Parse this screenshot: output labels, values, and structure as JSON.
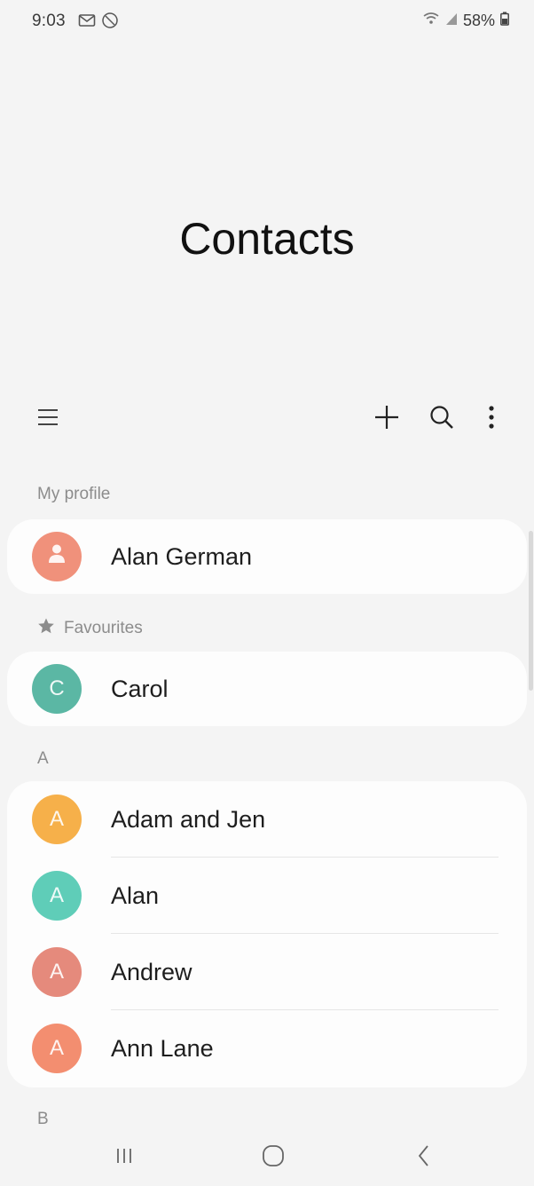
{
  "status_bar": {
    "time": "9:03",
    "battery": "58%"
  },
  "header": {
    "title": "Contacts"
  },
  "toolbar": {
    "icons": [
      "menu-icon",
      "add-icon",
      "search-icon",
      "more-options-icon"
    ]
  },
  "sections": {
    "profile": {
      "header": "My profile",
      "contact": {
        "name": "Alan German",
        "avatar_color": "#f0917b",
        "avatar_icon": "person-icon"
      }
    },
    "favourites": {
      "header": "Favourites",
      "contact": {
        "name": "Carol",
        "initial": "C",
        "avatar_color": "#5bb7a4"
      }
    },
    "group_a": {
      "header": "A",
      "contacts": [
        {
          "name": "Adam and Jen",
          "initial": "A",
          "avatar_color": "#f6b04a"
        },
        {
          "name": "Alan",
          "initial": "A",
          "avatar_color": "#5fcdb8"
        },
        {
          "name": "Andrew",
          "initial": "A",
          "avatar_color": "#e58a7c"
        },
        {
          "name": "Ann Lane",
          "initial": "A",
          "avatar_color": "#f38e70"
        }
      ]
    },
    "group_b": {
      "header": "B"
    }
  },
  "nav_bar": {
    "icons": [
      "recent-apps-icon",
      "home-icon",
      "back-icon"
    ]
  }
}
